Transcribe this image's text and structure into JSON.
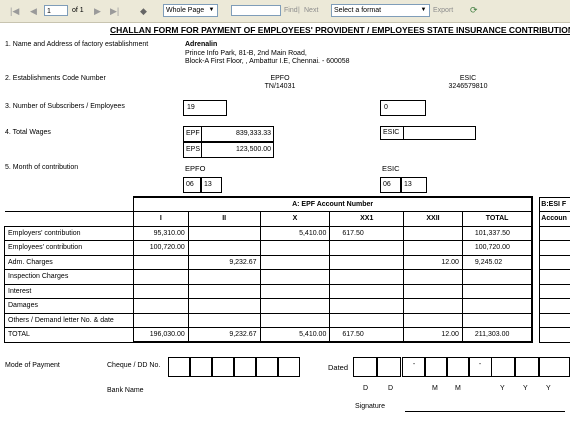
{
  "toolbar": {
    "page_value": "1",
    "page_of": "of 1",
    "zoom": "Whole Page",
    "find_placeholder": "",
    "find_label": "Find",
    "next_label": "Next",
    "separator": "|",
    "format_select": "Select a format",
    "export_label": "Export"
  },
  "form": {
    "title": "CHALLAN FORM FOR PAYMENT OF EMPLOYEES' PROVIDENT / EMPLOYEES STATE INSURANCE CONTRIBUTION",
    "s1_label": "1. Name and Address of factory establishment",
    "company_name": "Adrenalin",
    "address_line1": "Prince Info Park, 81-B, 2nd Main Road,",
    "address_line2": "Block-A First Floor, , Ambattur I.E, Chennai. - 600058",
    "s2_label": "2. Establishments Code Number",
    "epfo_head": "EPFO",
    "epfo_code": "TN/14031",
    "esic_head": "ESIC",
    "esic_code": "3246579810",
    "s3_label": "3. Number of Subscribers / Employees",
    "subscribers_epf": "19",
    "subscribers_esic": "0",
    "s4_label": "4. Total Wages",
    "epf_tag": "EPF",
    "epf_wages": "839,333.33",
    "eps_tag": "EPS",
    "eps_wages": "123,500.00",
    "esic_tag": "ESIC",
    "esic_wages": "",
    "s5_label": "5. Month of contribution",
    "epfo_label": "EPFO",
    "esic_label": "ESIC",
    "epfo_month": "06",
    "epfo_year": "13",
    "esic_month": "06",
    "esic_year": "13"
  },
  "table": {
    "group_header": "A: EPF Account Number",
    "right_group_header": "B:ESI F",
    "right_sub_header": "Accoun",
    "columns": [
      "I",
      "II",
      "X",
      "XX1",
      "XXII",
      "TOTAL"
    ],
    "rows": [
      {
        "label": "Employers' contribution",
        "cells": [
          "95,310.00",
          "",
          "5,410.00",
          "617.50",
          "",
          "101,337.50"
        ]
      },
      {
        "label": "Employees' contribution",
        "cells": [
          "100,720.00",
          "",
          "",
          "",
          "",
          "100,720.00"
        ]
      },
      {
        "label": "Adm. Charges",
        "cells": [
          "",
          "9,232.67",
          "",
          "",
          "12.00",
          "9,245.02"
        ]
      },
      {
        "label": "Inspection Charges",
        "cells": [
          "",
          "",
          "",
          "",
          "",
          ""
        ]
      },
      {
        "label": "Interest",
        "cells": [
          "",
          "",
          "",
          "",
          "",
          ""
        ]
      },
      {
        "label": "Damages",
        "cells": [
          "",
          "",
          "",
          "",
          "",
          ""
        ]
      },
      {
        "label": "Others / Demand letter No. & date",
        "cells": [
          "",
          "",
          "",
          "",
          "",
          ""
        ]
      },
      {
        "label": "TOTAL",
        "cells": [
          "196,030.00",
          "9,232.67",
          "5,410.00",
          "617.50",
          "12.00",
          "211,303.00"
        ]
      }
    ]
  },
  "payment": {
    "mode_label": "Mode of Payment",
    "cheque_label": "Cheque / DD No.",
    "dated_label": "Dated",
    "dash": "-",
    "date_letters": [
      "D",
      "D",
      "M",
      "M",
      "Y",
      "Y",
      "Y"
    ],
    "bank_label": "Bank Name",
    "signature_label": "Signature"
  }
}
